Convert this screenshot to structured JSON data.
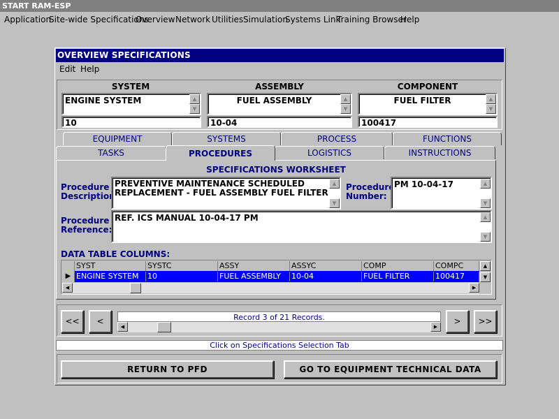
{
  "app": {
    "title": "START RAM-ESP"
  },
  "menu": [
    "Application",
    "Site-wide Specifications",
    "Overview",
    "Network",
    "Utilities",
    "Simulation",
    "Systems Link",
    "Training Browser",
    "Help"
  ],
  "window": {
    "title": "OVERVIEW SPECIFICATIONS",
    "menu": {
      "edit": "Edit",
      "help": "Help"
    }
  },
  "selectors": {
    "system": {
      "header": "SYSTEM",
      "name": "ENGINE SYSTEM",
      "code": "10"
    },
    "assembly": {
      "header": "ASSEMBLY",
      "name": "FUEL ASSEMBLY",
      "code": "10-04"
    },
    "component": {
      "header": "COMPONENT",
      "name": "FUEL FILTER",
      "code": "100417"
    }
  },
  "tabs": {
    "row1": [
      "EQUIPMENT",
      "SYSTEMS",
      "PROCESS",
      "FUNCTIONS"
    ],
    "row2": [
      "TASKS",
      "PROCEDURES",
      "LOGISTICS",
      "INSTRUCTIONS"
    ],
    "active": "PROCEDURES"
  },
  "worksheet": {
    "title": "SPECIFICATIONS WORKSHEET",
    "description_label": "Procedure Description:",
    "description_line1": "PREVENTIVE MAINTENANCE SCHEDULED",
    "description_line2": "REPLACEMENT - FUEL ASSEMBLY FUEL FILTER",
    "number_label": "Procedure Number:",
    "number_value": "PM 10-04-17",
    "reference_label": "Procedure Reference:",
    "reference_value": "REF. ICS MANUAL 10-04-17 PM"
  },
  "grid": {
    "label": "DATA TABLE COLUMNS:",
    "columns": [
      "SYST",
      "SYSTC",
      "ASSY",
      "ASSYC",
      "COMP",
      "COMPC"
    ],
    "row": [
      "ENGINE SYSTEM",
      "10",
      "FUEL ASSEMBLY",
      "10-04",
      "FUEL FILTER",
      "100417"
    ]
  },
  "nav": {
    "first": "<<",
    "prev": "<",
    "next": ">",
    "last": ">>",
    "record_text": "Record 3 of 21 Records."
  },
  "status": "Click on Specifications Selection Tab",
  "buttons": {
    "return": "RETURN TO PFD",
    "goto": "GO TO EQUIPMENT TECHNICAL DATA"
  },
  "colors": {
    "navy": "#000080",
    "selection": "#0000ff",
    "face": "#c0c0c0"
  }
}
